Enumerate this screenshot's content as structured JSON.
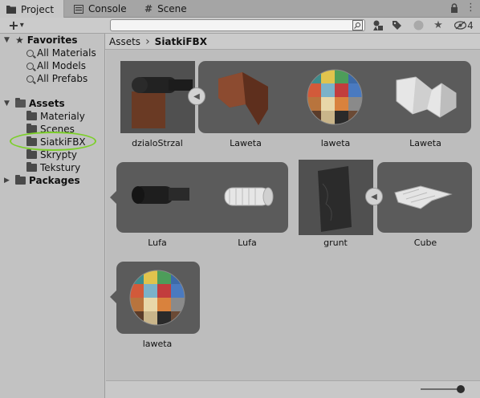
{
  "tabs": [
    {
      "label": "Project",
      "icon": "folder-icon"
    },
    {
      "label": "Console",
      "icon": "console-icon"
    },
    {
      "label": "Scene",
      "icon": "hash-icon"
    }
  ],
  "toolbar": {
    "add_label": "+",
    "add_dropdown": "▾",
    "search_placeholder": "",
    "hidden_count": "4"
  },
  "sidebar": {
    "favorites": {
      "label": "Favorites",
      "items": [
        "All Materials",
        "All Models",
        "All Prefabs"
      ]
    },
    "assets": {
      "label": "Assets",
      "items": [
        "Materialy",
        "Scenes",
        "SiatkiFBX",
        "Skrypty",
        "Tekstury"
      ],
      "selected": "SiatkiFBX"
    },
    "packages": {
      "label": "Packages"
    }
  },
  "breadcrumb": {
    "root": "Assets",
    "separator": "›",
    "current": "SiatkiFBX"
  },
  "assets_grid": {
    "row1": [
      "dzialoStrzal",
      "Laweta",
      "laweta",
      "Laweta"
    ],
    "row2": [
      "Lufa",
      "Lufa",
      "grunt",
      "Cube"
    ],
    "row3": [
      "laweta"
    ]
  },
  "colors": {
    "highlight_ring": "#7ccf2a",
    "group_bg": "#5b5b5b",
    "panel_bg": "#c8c8c8"
  },
  "zoom_slider": {
    "value_fraction": 0.9
  }
}
